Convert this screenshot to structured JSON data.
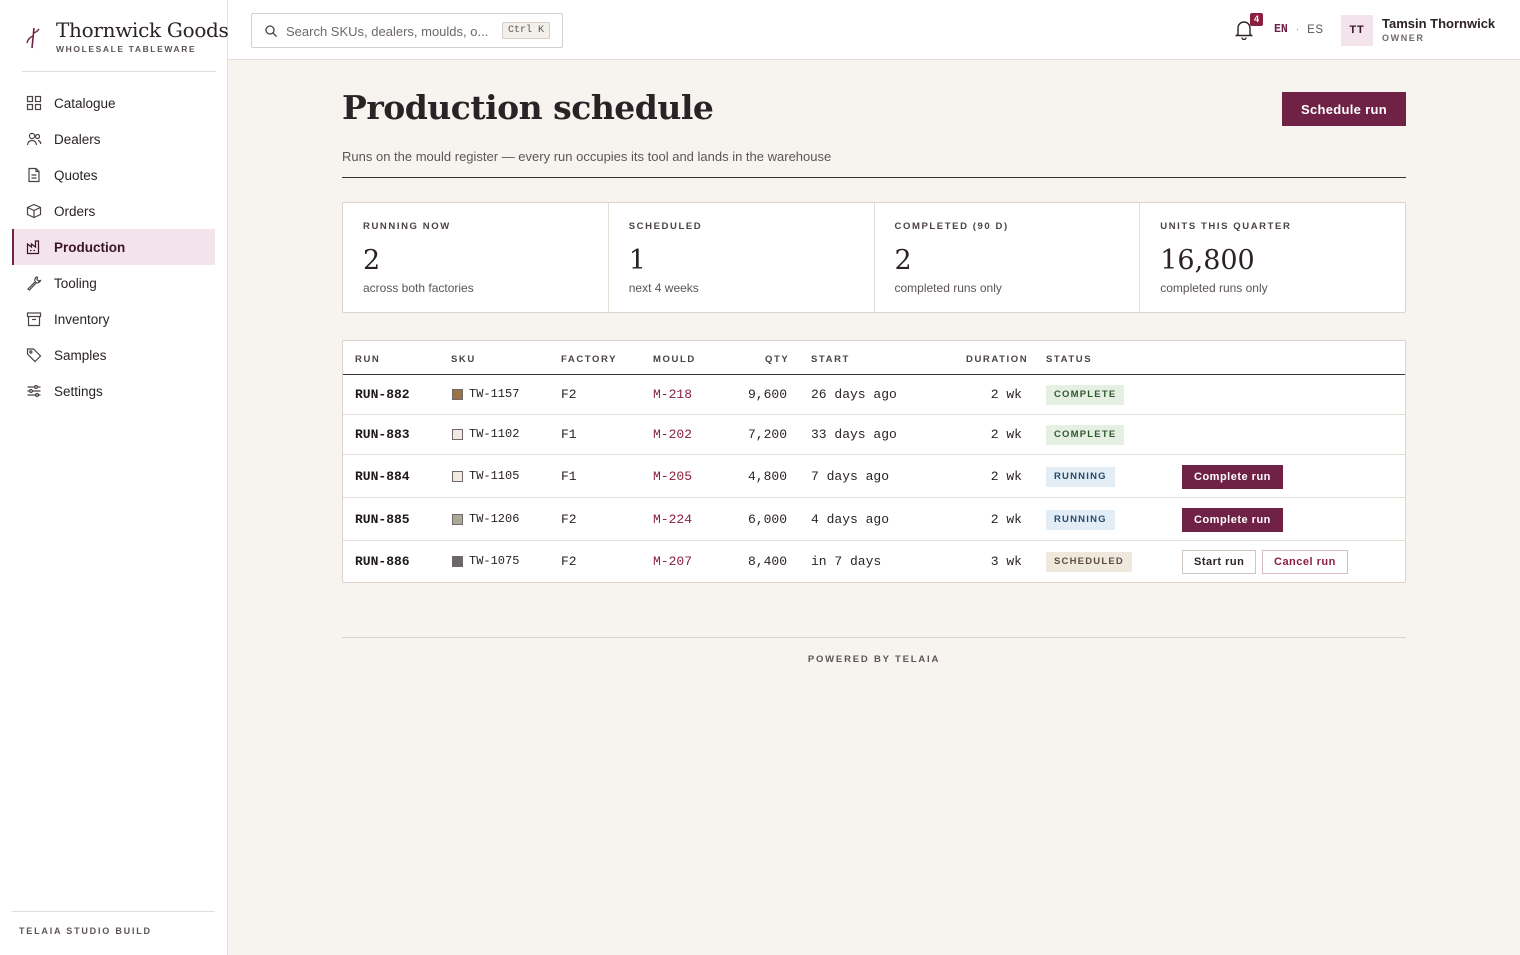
{
  "brand": {
    "name": "Thornwick Goods",
    "tagline": "WHOLESALE TABLEWARE"
  },
  "nav": {
    "items": [
      {
        "label": "Catalogue",
        "icon": "grid-icon",
        "active": false
      },
      {
        "label": "Dealers",
        "icon": "users-icon",
        "active": false
      },
      {
        "label": "Quotes",
        "icon": "document-icon",
        "active": false
      },
      {
        "label": "Orders",
        "icon": "box-icon",
        "active": false
      },
      {
        "label": "Production",
        "icon": "factory-icon",
        "active": true
      },
      {
        "label": "Tooling",
        "icon": "wrench-icon",
        "active": false
      },
      {
        "label": "Inventory",
        "icon": "archive-icon",
        "active": false
      },
      {
        "label": "Samples",
        "icon": "tag-icon",
        "active": false
      },
      {
        "label": "Settings",
        "icon": "sliders-icon",
        "active": false
      }
    ]
  },
  "sidebar_footer": "TELAIA STUDIO BUILD",
  "search": {
    "placeholder": "Search SKUs, dealers, moulds, o...",
    "value": "",
    "shortcut": "Ctrl K"
  },
  "notifications": {
    "count": "4"
  },
  "language": {
    "current": "EN",
    "separator": "·",
    "other": "ES"
  },
  "user": {
    "initials": "TT",
    "name": "Tamsin Thornwick",
    "role": "OWNER"
  },
  "page": {
    "title": "Production schedule",
    "subtitle": "Runs on the mould register — every run occupies its tool and lands in the warehouse",
    "primary_action": "Schedule run"
  },
  "stats": [
    {
      "label": "RUNNING NOW",
      "value": "2",
      "note": "across both factories"
    },
    {
      "label": "SCHEDULED",
      "value": "1",
      "note": "next 4 weeks"
    },
    {
      "label": "COMPLETED (90 D)",
      "value": "2",
      "note": "completed runs only"
    },
    {
      "label": "UNITS THIS QUARTER",
      "value": "16,800",
      "note": "completed runs only"
    }
  ],
  "table": {
    "headers": {
      "run": "RUN",
      "sku": "SKU",
      "factory": "FACTORY",
      "mould": "MOULD",
      "qty": "QTY",
      "start": "START",
      "duration": "DURATION",
      "status": "STATUS"
    },
    "rows": [
      {
        "run": "RUN-882",
        "swatch": "#9a7445",
        "sku": "TW-1157",
        "factory": "F2",
        "mould": "M-218",
        "qty": "9,600",
        "start": "26 days ago",
        "duration": "2 wk",
        "status": "COMPLETE",
        "status_kind": "complete",
        "actions": []
      },
      {
        "run": "RUN-883",
        "swatch": "#efe9df",
        "sku": "TW-1102",
        "factory": "F1",
        "mould": "M-202",
        "qty": "7,200",
        "start": "33 days ago",
        "duration": "2 wk",
        "status": "COMPLETE",
        "status_kind": "complete",
        "actions": []
      },
      {
        "run": "RUN-884",
        "swatch": "#f1ebe2",
        "sku": "TW-1105",
        "factory": "F1",
        "mould": "M-205",
        "qty": "4,800",
        "start": "7 days ago",
        "duration": "2 wk",
        "status": "RUNNING",
        "status_kind": "running",
        "actions": [
          {
            "label": "Complete run",
            "kind": "fill"
          }
        ]
      },
      {
        "run": "RUN-885",
        "swatch": "#a9ab96",
        "sku": "TW-1206",
        "factory": "F2",
        "mould": "M-224",
        "qty": "6,000",
        "start": "4 days ago",
        "duration": "2 wk",
        "status": "RUNNING",
        "status_kind": "running",
        "actions": [
          {
            "label": "Complete run",
            "kind": "fill"
          }
        ]
      },
      {
        "run": "RUN-886",
        "swatch": "#6b6868",
        "sku": "TW-1075",
        "factory": "F2",
        "mould": "M-207",
        "qty": "8,400",
        "start": "in 7 days",
        "duration": "3 wk",
        "status": "SCHEDULED",
        "status_kind": "scheduled",
        "actions": [
          {
            "label": "Start run",
            "kind": "outline"
          },
          {
            "label": "Cancel run",
            "kind": "danger"
          }
        ]
      }
    ]
  },
  "powered_by": "POWERED BY TELAIA",
  "colors": {
    "accent": "#6f2146",
    "accent_soft": "#f3e3ea",
    "background": "#f7f4ef"
  }
}
